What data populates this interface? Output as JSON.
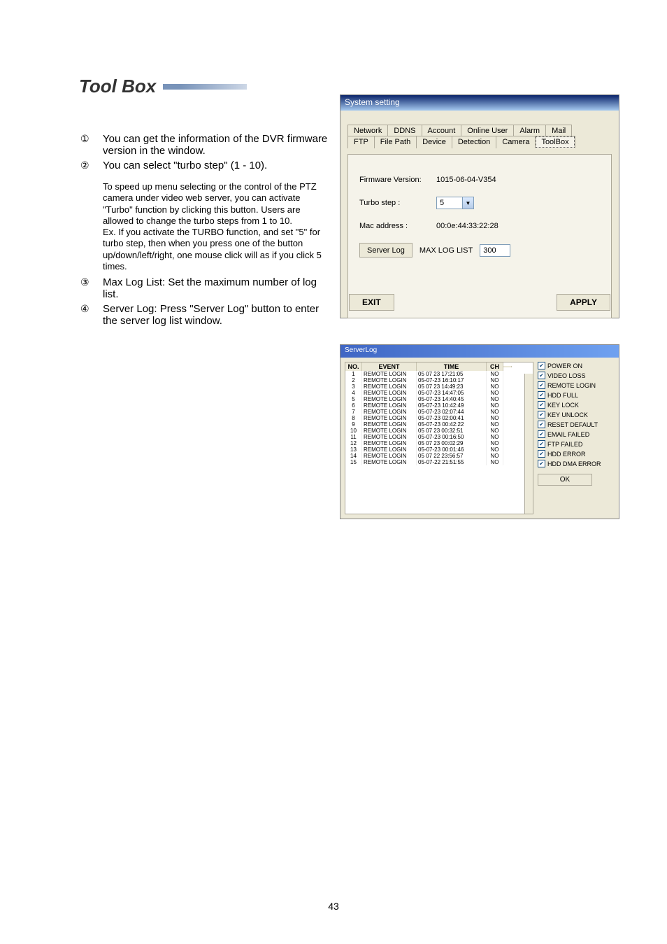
{
  "pageNumber": "43",
  "title": "Tool Box",
  "body": {
    "items": [
      "You can get the information of the DVR firmware version in the window.",
      "You can select \"turbo step\" (1 - 10).",
      "Max Log List: Set the maximum number of log list.",
      "Server Log: Press \"Server Log\" button to enter the server log list window."
    ],
    "para": "To speed up menu selecting or the control of the PTZ camera under video web server, you can activate \"Turbo\" function by clicking this button. Users are allowed to change the turbo steps from 1 to 10.\nEx. If you activate the TURBO function, and set \"5\" for turbo step, then when you press one of the button up/down/left/right, one mouse click will as if you click 5 times."
  },
  "systemSetting": {
    "title": "System setting",
    "tabsRow1": [
      "Network",
      "DDNS",
      "Account",
      "Online User",
      "Alarm",
      "Mail"
    ],
    "tabsRow2": [
      "FTP",
      "File Path",
      "Device",
      "Detection",
      "Camera",
      "ToolBox"
    ],
    "selectedTab": "ToolBox",
    "firmwareLabel": "Firmware Version:",
    "firmwareValue": "1015-06-04-V354",
    "turboLabel": "Turbo step :",
    "turboValue": "5",
    "macLabel": "Mac address :",
    "macValue": "00:0e:44:33:22:28",
    "serverLogBtn": "Server Log",
    "maxLogListLabel": "MAX LOG LIST",
    "maxLogListValue": "300",
    "exit": "EXIT",
    "apply": "APPLY"
  },
  "serverLog": {
    "title": "ServerLog",
    "headers": [
      "NO.",
      "EVENT",
      "TIME",
      "CH",
      ""
    ],
    "rows": [
      [
        "1",
        "REMOTE LOGIN",
        "05 07 23 17:21:05",
        "NO"
      ],
      [
        "2",
        "REMOTE LOGIN",
        "05-07-23 16:10:17",
        "NO"
      ],
      [
        "3",
        "REMOTE LOGIN",
        "05 07 23 14:49:23",
        "NO"
      ],
      [
        "4",
        "REMOTE LOGIN",
        "05-07-23 14:47:05",
        "NO"
      ],
      [
        "5",
        "REMOTE LOGIN",
        "05-07-23 14:40:45",
        "NO"
      ],
      [
        "6",
        "REMOTE LOGIN",
        "05-07-23 10:42:49",
        "NO"
      ],
      [
        "7",
        "REMOTE LOGIN",
        "05-07-23 02:07:44",
        "NO"
      ],
      [
        "8",
        "REMOTE LOGIN",
        "05-07-23 02:00:41",
        "NO"
      ],
      [
        "9",
        "REMOTE LOGIN",
        "05-07-23 00:42:22",
        "NO"
      ],
      [
        "10",
        "REMOTE LOGIN",
        "05 07 23 00:32:51",
        "NO"
      ],
      [
        "11",
        "REMOTE LOGIN",
        "05-07-23 00:16:50",
        "NO"
      ],
      [
        "12",
        "REMOTE LOGIN",
        "05 07 23 00:02:29",
        "NO"
      ],
      [
        "13",
        "REMOTE LOGIN",
        "05-07-23 00:01:46",
        "NO"
      ],
      [
        "14",
        "REMOTE LOGIN",
        "05 07 22 23:56:57",
        "NO"
      ],
      [
        "15",
        "REMOTE LOGIN",
        "05-07-22 21:51:55",
        "NO"
      ]
    ],
    "filters": [
      {
        "label": "POWER ON",
        "checked": true
      },
      {
        "label": "VIDEO LOSS",
        "checked": true
      },
      {
        "label": "REMOTE LOGIN",
        "checked": true
      },
      {
        "label": "HDD FULL",
        "checked": true
      },
      {
        "label": "KEY LOCK",
        "checked": true
      },
      {
        "label": "KEY UNLOCK",
        "checked": true
      },
      {
        "label": "RESET DEFAULT",
        "checked": true
      },
      {
        "label": "EMAIL FAILED",
        "checked": true
      },
      {
        "label": "FTP FAILED",
        "checked": true
      },
      {
        "label": "HDD ERROR",
        "checked": true
      },
      {
        "label": "HDD DMA ERROR",
        "checked": true
      }
    ],
    "ok": "OK"
  }
}
